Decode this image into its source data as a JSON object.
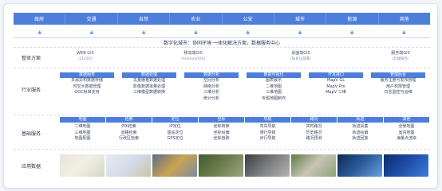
{
  "topbar": [
    "政府",
    "交通",
    "自然",
    "农业",
    "公安",
    "城市",
    "能源",
    "其他"
  ],
  "arrow_glyph": "▲",
  "slogan": "数字化城市：协同环境·一体化解决方案，数据服务中心",
  "rows": {
    "solutions": {
      "label": "整体方案",
      "items": [
        {
          "title": "WEB GIS",
          "sub": "（2D/3D）"
        },
        {
          "title": "移动端GIS",
          "sub": "（Android/iOS）"
        },
        {
          "title": "桌面端GIS",
          "sub": "（私有化部署）"
        },
        {
          "title": "服务端GIS",
          "sub": "（云端服务）"
        }
      ]
    },
    "services": {
      "label": "行业服务",
      "blocks": [
        {
          "title": "数据服务",
          "items": [
            "多源异构数据存储",
            "时空大数据管理",
            "OGC标准支持"
          ]
        },
        {
          "title": "数据处理",
          "items": [
            "矢量栅格数据处理",
            "影像数据批量处理",
            "三维模型数据转换"
          ]
        },
        {
          "title": "数据分析",
          "items": [
            "空间分析",
            "网络分析",
            "三维分析",
            "统计分析"
          ]
        },
        {
          "title": "数据可视化",
          "items": [
            "图表展示",
            "二维地图",
            "三维地图",
            "专题地图制作"
          ]
        },
        {
          "title": "开发接口",
          "items": [
            "MapV GL",
            "MapV Pro",
            "MapV 三维"
          ]
        },
        {
          "title": "管理后台",
          "items": [
            "服务注册与发布管理",
            "用户权限管理",
            "日志监控与运维"
          ]
        }
      ]
    },
    "base": {
      "label": "基础服务",
      "columns": [
        {
          "title": "地图",
          "items": [
            "二维地图",
            "三维地图",
            "地图配图"
          ]
        },
        {
          "title": "检索",
          "items": [
            "POI检索",
            "道路检索",
            "行政区检索"
          ]
        },
        {
          "title": "定位",
          "items": [
            "IP定位",
            "基站定位",
            "GPS定位"
          ]
        },
        {
          "title": "坐标",
          "items": [
            "坐标转换",
            "坐标纠偏",
            "坐标拾取"
          ]
        },
        {
          "title": "导航",
          "items": [
            "驾车导航",
            "骑行导航",
            "步行导航"
          ]
        },
        {
          "title": "路况",
          "items": [
            "实时路况",
            "历史路况",
            "路况预测"
          ]
        },
        {
          "title": "轨迹",
          "items": [
            "轨迹采集",
            "轨迹纠偏",
            "轨迹回放"
          ]
        },
        {
          "title": "其他",
          "items": [
            "全景地图",
            "室内地图",
            "海量点渲染"
          ]
        }
      ]
    },
    "data": {
      "label": "应用数据",
      "thumbs": [
        {
          "name": "vector-map",
          "colors": [
            "#e8e4d6",
            "#f2efe6",
            "#cfd9c3"
          ]
        },
        {
          "name": "road-map",
          "colors": [
            "#e6ebf3",
            "#d4dcea",
            "#c9c4a8"
          ]
        },
        {
          "name": "city-traffic",
          "colors": [
            "#5b6d86",
            "#c9a453",
            "#7e8ca1"
          ]
        },
        {
          "name": "aerial-green",
          "colors": [
            "#3f5a2f",
            "#6c7e4d",
            "#9ca585"
          ]
        },
        {
          "name": "aerial-city",
          "colors": [
            "#3b3d3f",
            "#7b7d80",
            "#b5b4b0"
          ]
        },
        {
          "name": "stadium",
          "colors": [
            "#5a7f45",
            "#c9c5b7",
            "#8ca175"
          ]
        },
        {
          "name": "night-view",
          "colors": [
            "#0d2a52",
            "#2b5b9a",
            "#6aa1de"
          ]
        },
        {
          "name": "data-screen",
          "colors": [
            "#0c2c6b",
            "#1f4fa8",
            "#3e7bd8"
          ]
        }
      ]
    }
  },
  "colors": {
    "accent": "#4d7fda",
    "text": "#2b3550"
  }
}
